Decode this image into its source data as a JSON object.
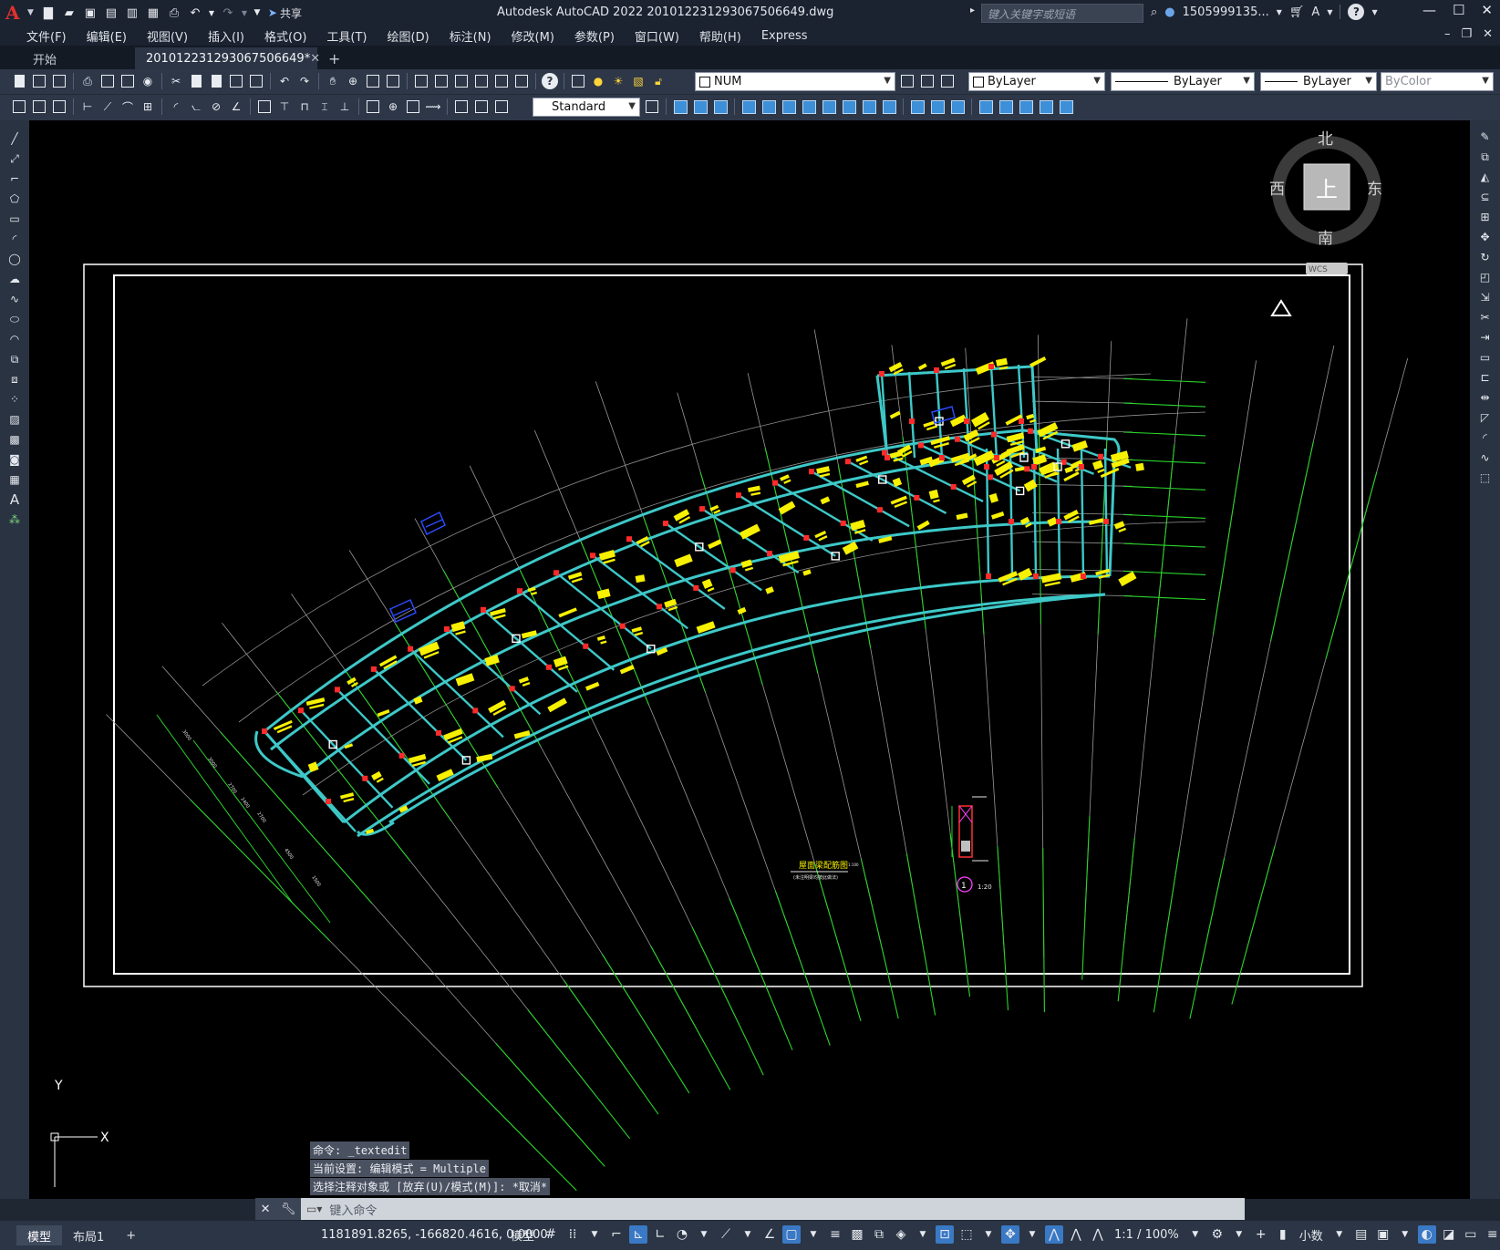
{
  "app": {
    "logo": "A",
    "title": "Autodesk AutoCAD 2022   201012231293067506649.dwg",
    "search_placeholder": "键入关键字或短语",
    "user": "1505999135...",
    "share_label": "共享"
  },
  "menu": [
    "文件(F)",
    "编辑(E)",
    "视图(V)",
    "插入(I)",
    "格式(O)",
    "工具(T)",
    "绘图(D)",
    "标注(N)",
    "修改(M)",
    "参数(P)",
    "窗口(W)",
    "帮助(H)",
    "Express"
  ],
  "tabs": {
    "start": "开始",
    "active": "201012231293067506649*",
    "close": "✕",
    "add": "+"
  },
  "toolbar": {
    "layer_value": "NUM",
    "color_value": "ByLayer",
    "linetype_value": "ByLayer",
    "lineweight_value": "ByLayer",
    "plotstyle_value": "ByColor",
    "textstyle_value": "Standard"
  },
  "viewcube": {
    "north": "北",
    "south": "南",
    "east": "东",
    "west": "西",
    "face": "上",
    "wcs": "WCS"
  },
  "drawing": {
    "plan_title": "屋面梁配筋图",
    "plan_scale": "1:100",
    "plan_subtitle": "(未注明梁均按此做法)",
    "detail_number": "1",
    "detail_scale": "1:20"
  },
  "ucs": {
    "x": "X",
    "y": "Y"
  },
  "command": {
    "history": [
      "命令: _textedit",
      "当前设置: 编辑模式 = Multiple",
      "选择注释对象或 [放弃(U)/模式(M)]: *取消*"
    ],
    "placeholder": "键入命令"
  },
  "status": {
    "model_tab": "模型",
    "layout_tab": "布局1",
    "add_tab": "+",
    "coords": "1181891.8265, -166820.4616, 0.0000",
    "space": "模型",
    "scale": "1:1 / 100%",
    "units": "小数"
  }
}
